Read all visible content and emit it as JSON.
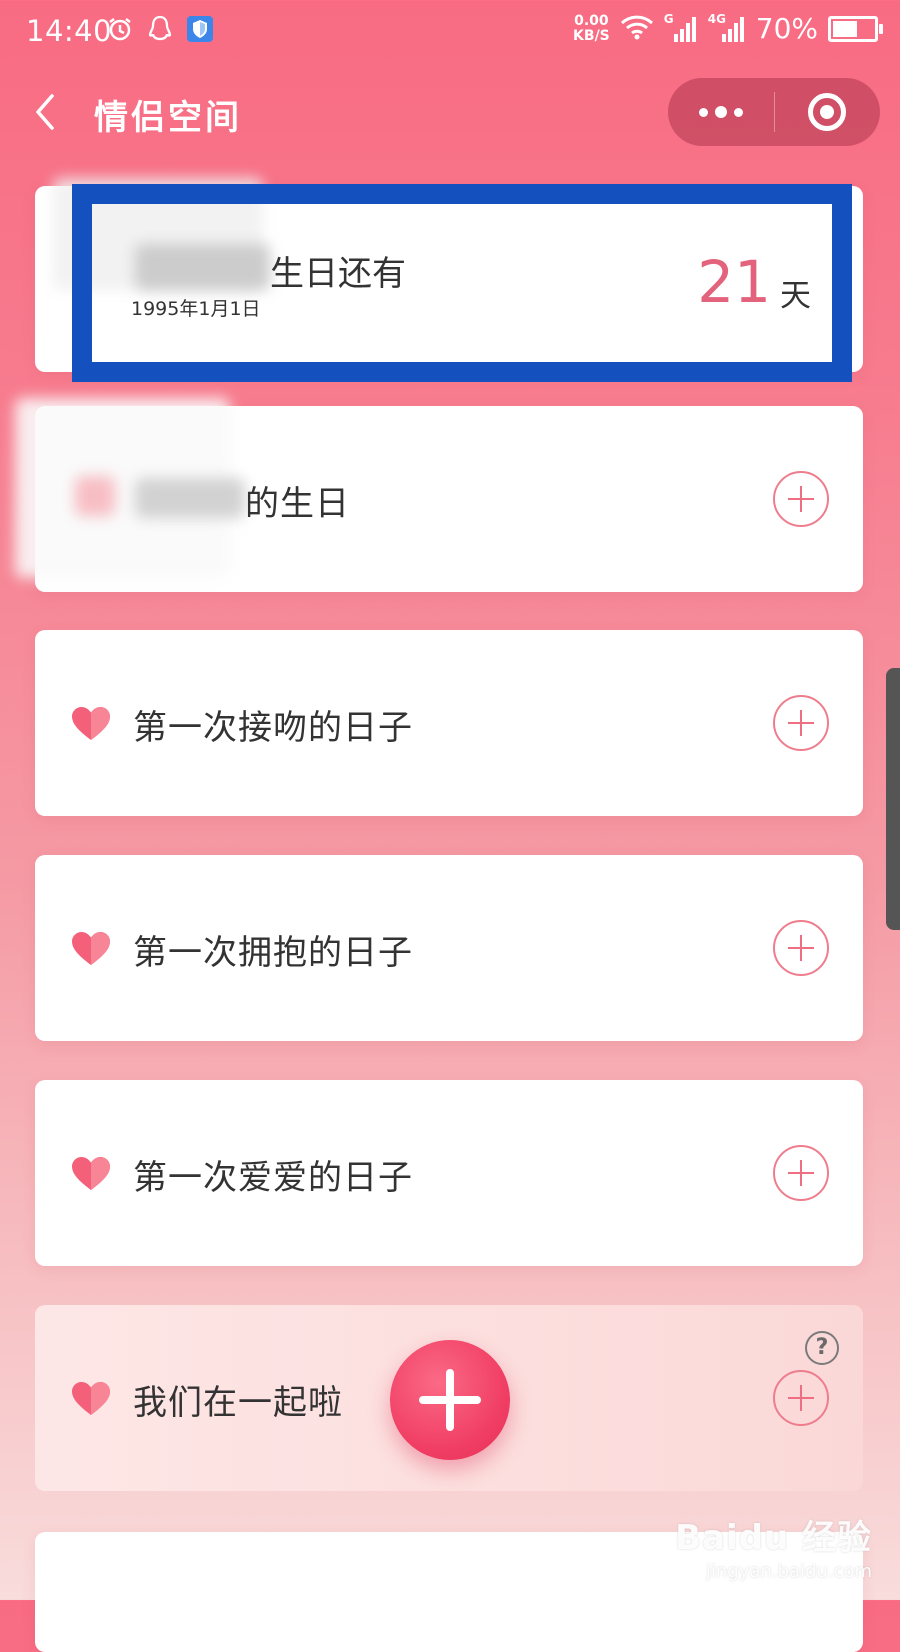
{
  "status_bar": {
    "time": "14:40",
    "speed_value": "0.00",
    "speed_unit": "KB/S",
    "signal_1_label": "G",
    "signal_2_label": "4G",
    "battery_text": "70%",
    "battery_level": 0.7
  },
  "navbar": {
    "title": "情侣空间"
  },
  "countdown_card": {
    "label_suffix": "生日还有",
    "date": "1995年1月1日",
    "days": "21",
    "unit": "天"
  },
  "cards": [
    {
      "label": "的生日"
    },
    {
      "label": "第一次接吻的日子"
    },
    {
      "label": "第一次拥抱的日子"
    },
    {
      "label": "第一次爱爱的日子"
    },
    {
      "label": "我们在一起啦"
    }
  ],
  "help_mark": "?",
  "watermark": {
    "logo": "Baidu 经验",
    "url": "jingyan.baidu.com"
  },
  "colors": {
    "accent": "#e2637b",
    "highlight_border": "#1451be",
    "heart": "#f4607a"
  }
}
